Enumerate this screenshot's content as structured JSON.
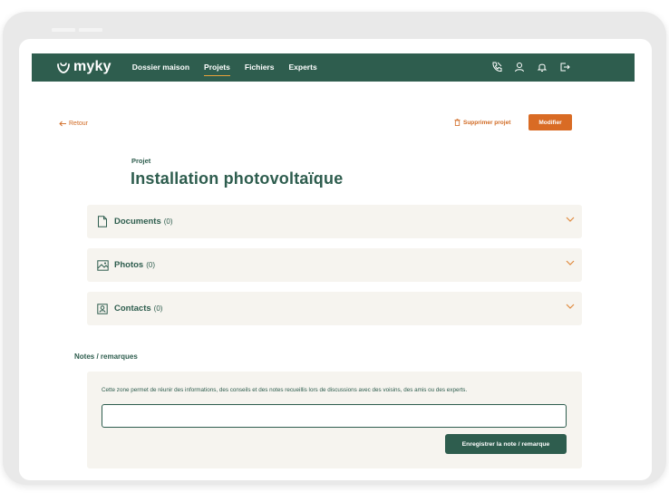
{
  "brand": {
    "name": "myky"
  },
  "nav": {
    "links": [
      {
        "label": "Dossier maison",
        "active": false
      },
      {
        "label": "Projets",
        "active": true
      },
      {
        "label": "Fichiers",
        "active": false
      },
      {
        "label": "Experts",
        "active": false
      }
    ],
    "icons": [
      "phone-icon",
      "user-icon",
      "bell-icon",
      "logout-icon"
    ]
  },
  "toolbar": {
    "back_label": "Retour",
    "delete_label": "Supprimer projet",
    "edit_label": "Modifier"
  },
  "project": {
    "label": "Projet",
    "title": "Installation photovoltaïque"
  },
  "sections": [
    {
      "title": "Documents",
      "count": "(0)",
      "icon": "document-icon"
    },
    {
      "title": "Photos",
      "count": "(0)",
      "icon": "image-icon"
    },
    {
      "title": "Contacts",
      "count": "(0)",
      "icon": "contact-icon"
    }
  ],
  "notes": {
    "label": "Notes / remarques",
    "help": "Cette zone permet de réunir des informations, des conseils et des notes recueillis lors de discussions avec des voisins, des amis ou des experts.",
    "value": "",
    "save_label": "Enregistrer la note / remarque"
  },
  "colors": {
    "primary": "#2e5d4e",
    "accent": "#d96b24",
    "panel": "#f6f4ef",
    "underline": "#e9a23b"
  }
}
